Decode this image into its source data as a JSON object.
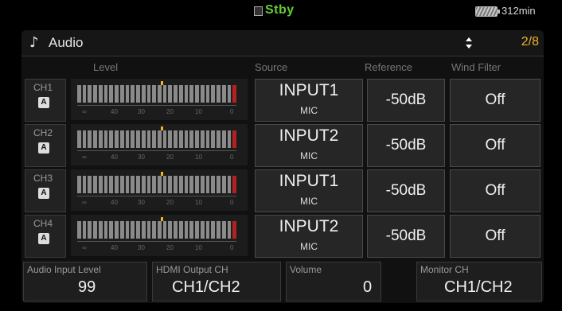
{
  "status": {
    "mode": "Stby",
    "battery_time": "312min"
  },
  "menu": {
    "title": "Audio",
    "page": "2/8"
  },
  "columns": {
    "level": "Level",
    "source": "Source",
    "reference": "Reference",
    "wind_filter": "Wind Filter"
  },
  "meter_scale": [
    "∞",
    "40",
    "30",
    "20",
    "10",
    "0"
  ],
  "channels": [
    {
      "label": "CH1",
      "mode_icon": "A",
      "source": "INPUT1",
      "source_type": "MIC",
      "reference": "-50dB",
      "wind_filter": "Off"
    },
    {
      "label": "CH2",
      "mode_icon": "A",
      "source": "INPUT2",
      "source_type": "MIC",
      "reference": "-50dB",
      "wind_filter": "Off"
    },
    {
      "label": "CH3",
      "mode_icon": "A",
      "source": "INPUT1",
      "source_type": "MIC",
      "reference": "-50dB",
      "wind_filter": "Off"
    },
    {
      "label": "CH4",
      "mode_icon": "A",
      "source": "INPUT2",
      "source_type": "MIC",
      "reference": "-50dB",
      "wind_filter": "Off"
    }
  ],
  "bottom": {
    "audio_input_level": {
      "label": "Audio Input Level",
      "value": "99"
    },
    "hdmi_output_ch": {
      "label": "HDMI Output CH",
      "value": "CH1/CH2"
    },
    "volume": {
      "label": "Volume",
      "value": "0"
    },
    "monitor_ch": {
      "label": "Monitor CH",
      "value": "CH1/CH2"
    }
  },
  "colors": {
    "accent": "#f0b429",
    "stby": "#66cc33",
    "meter_peak": "#b22222"
  }
}
